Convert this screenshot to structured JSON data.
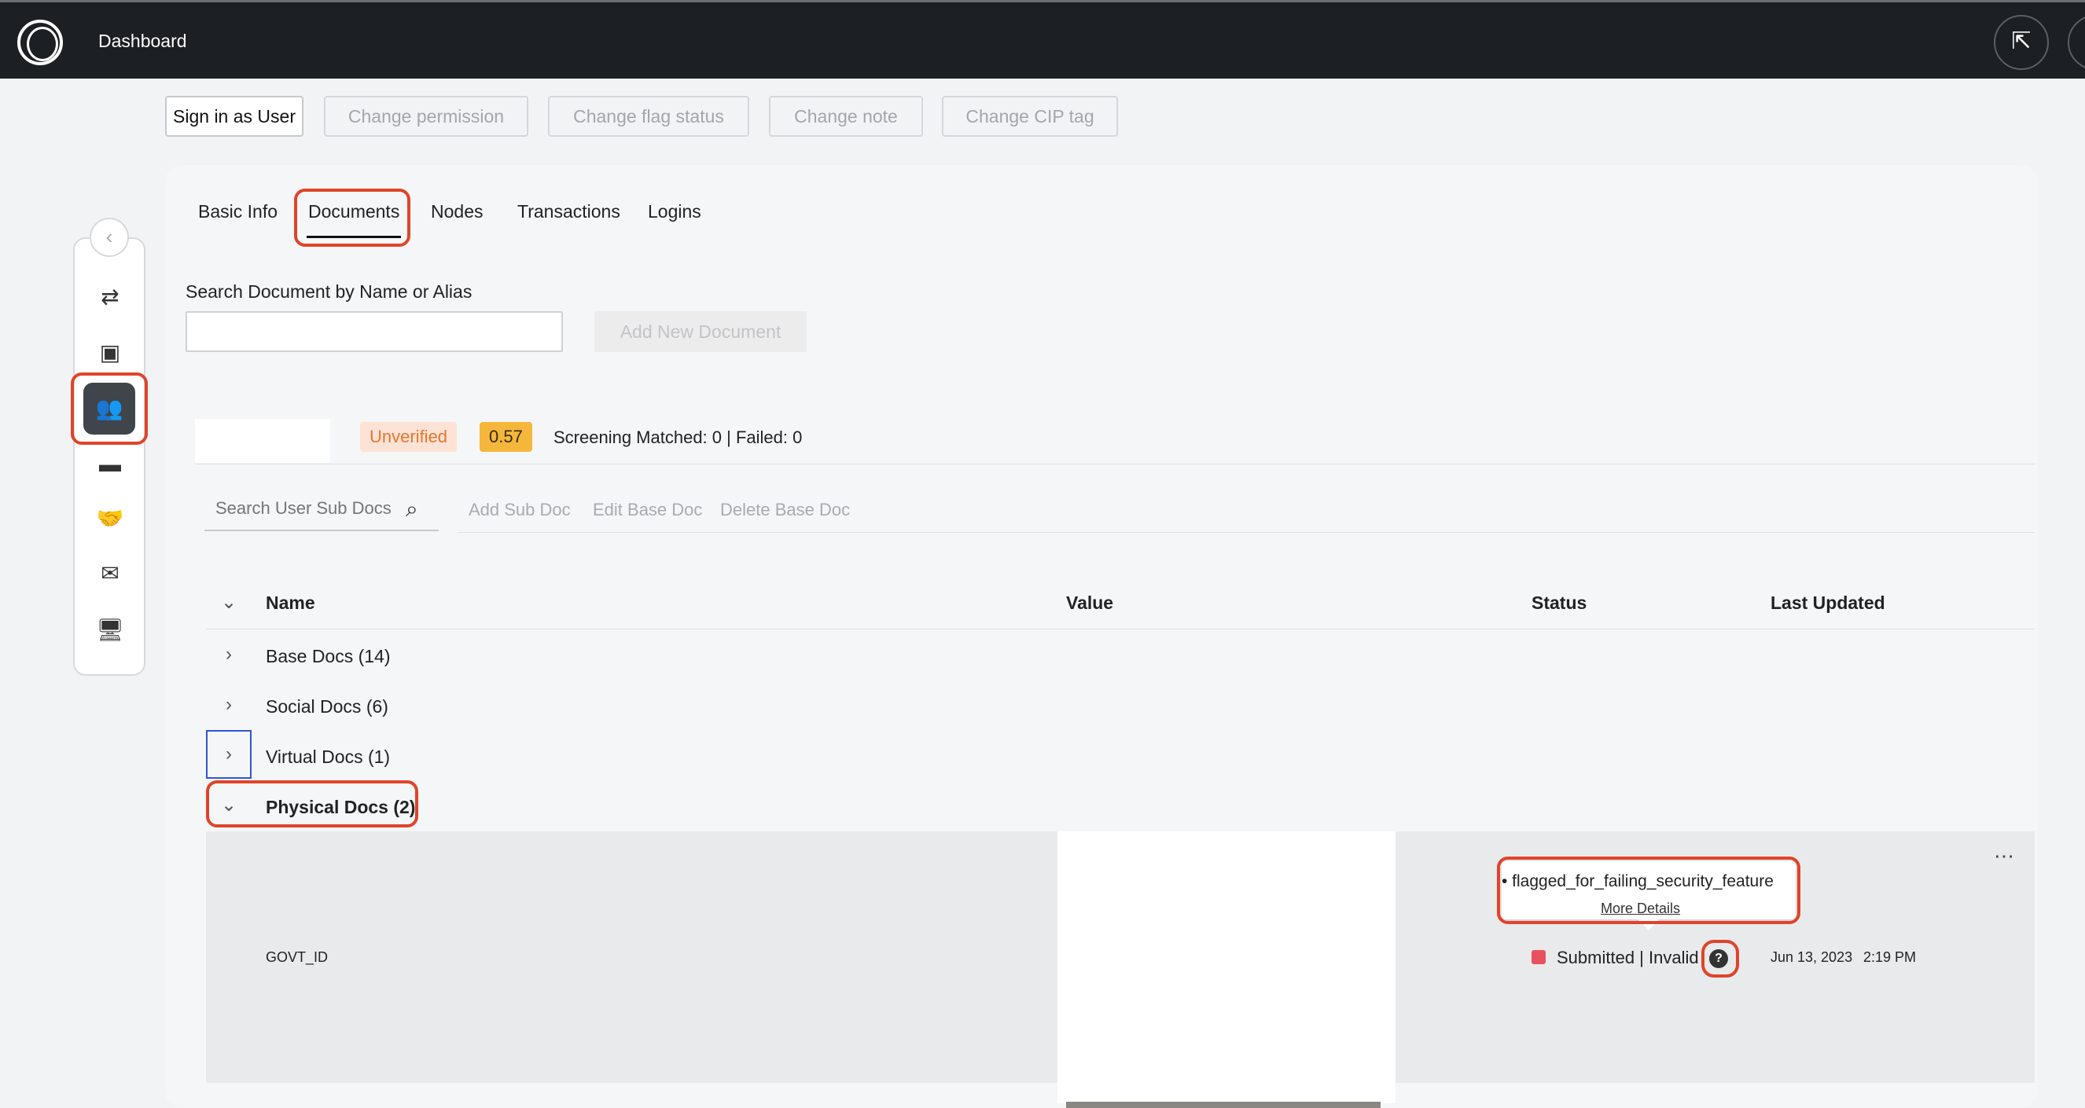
{
  "header": {
    "title": "Dashboard",
    "top_icon": "exit-icon"
  },
  "actions": {
    "sign_in": "Sign in as User",
    "change_permission": "Change permission",
    "change_flag": "Change flag status",
    "change_note": "Change note",
    "change_cip": "Change CIP tag"
  },
  "rail": {
    "collapse": "‹",
    "icons": [
      "transfer-icon",
      "inbox-icon",
      "users-icon",
      "ticket-icon",
      "handshake-icon",
      "mail-icon",
      "monitor-icon"
    ]
  },
  "tabs": [
    "Basic Info",
    "Documents",
    "Nodes",
    "Transactions",
    "Logins"
  ],
  "documents": {
    "search_label": "Search Document by Name or Alias",
    "search_value": "",
    "add_new": "Add New Document",
    "badge_status": "Unverified",
    "badge_score": "0.57",
    "screening": "Screening Matched: 0 | Failed: 0",
    "subdoc_placeholder": "Search User Sub Docs",
    "add_sub_doc": "Add Sub Doc",
    "edit_base_doc": "Edit Base Doc",
    "delete_base_doc": "Delete Base Doc"
  },
  "table": {
    "headers": {
      "name": "Name",
      "value": "Value",
      "status": "Status",
      "updated": "Last Updated"
    },
    "groups": [
      "Base Docs (14)",
      "Social Docs (6)",
      "Virtual Docs (1)",
      "Physical Docs (2)"
    ],
    "row": {
      "name": "GOVT_ID",
      "flag": "• flagged_for_failing_security_feature",
      "more_details": "More Details",
      "status": "Submitted | Invalid",
      "status_color": "#e8525e",
      "date": "Jun 13, 2023",
      "time": "2:19 PM",
      "more": "⋯"
    }
  },
  "colors": {
    "highlight": "#e04429",
    "topbar": "#1c2024",
    "unverified": "#e8752f",
    "score": "#f5b73b"
  }
}
